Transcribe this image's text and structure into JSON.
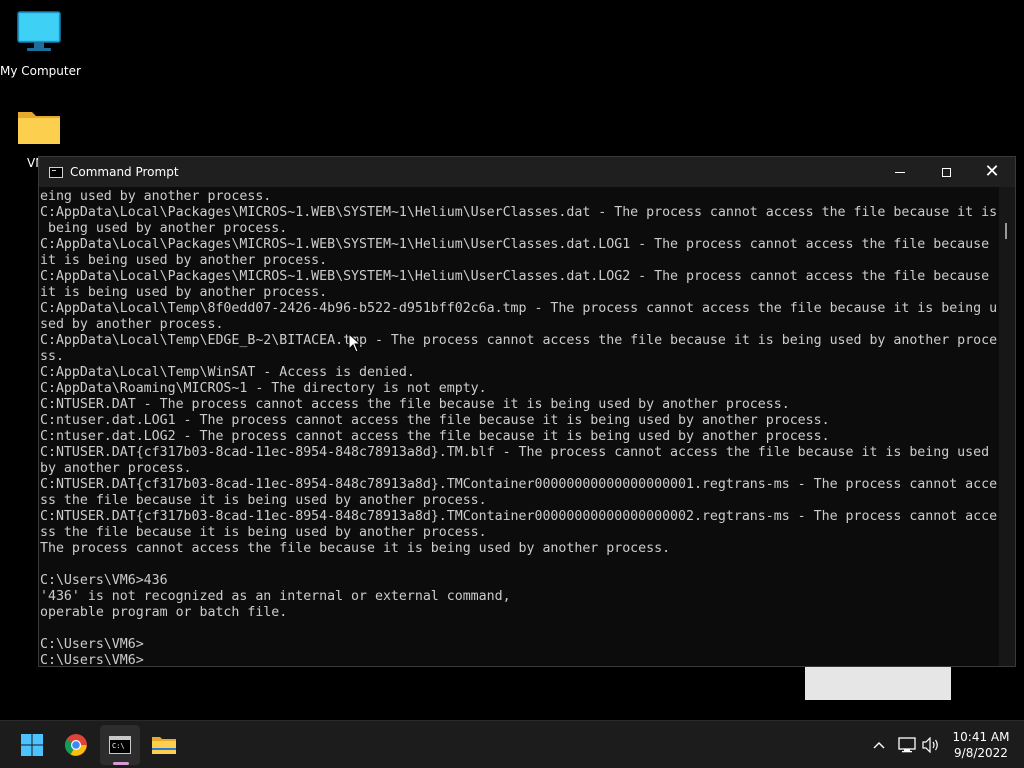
{
  "desktop": {
    "icons": [
      {
        "label": "My Computer",
        "icon": "monitor-icon"
      },
      {
        "label": "VM",
        "icon": "folder-icon"
      }
    ]
  },
  "window": {
    "title": "Command Prompt",
    "controls": {
      "minimize": "minimize-icon",
      "maximize": "maximize-icon",
      "close": "close-icon"
    },
    "console_lines": [
      "eing used by another process.",
      "C:AppData\\Local\\Packages\\MICROS~1.WEB\\SYSTEM~1\\Helium\\UserClasses.dat - The process cannot access the file because it is",
      " being used by another process.",
      "C:AppData\\Local\\Packages\\MICROS~1.WEB\\SYSTEM~1\\Helium\\UserClasses.dat.LOG1 - The process cannot access the file because",
      "it is being used by another process.",
      "C:AppData\\Local\\Packages\\MICROS~1.WEB\\SYSTEM~1\\Helium\\UserClasses.dat.LOG2 - The process cannot access the file because",
      "it is being used by another process.",
      "C:AppData\\Local\\Temp\\8f0edd07-2426-4b96-b522-d951bff02c6a.tmp - The process cannot access the file because it is being u",
      "sed by another process.",
      "C:AppData\\Local\\Temp\\EDGE_B~2\\BITACEA.tmp - The process cannot access the file because it is being used by another proce",
      "ss.",
      "C:AppData\\Local\\Temp\\WinSAT - Access is denied.",
      "C:AppData\\Roaming\\MICROS~1 - The directory is not empty.",
      "C:NTUSER.DAT - The process cannot access the file because it is being used by another process.",
      "C:ntuser.dat.LOG1 - The process cannot access the file because it is being used by another process.",
      "C:ntuser.dat.LOG2 - The process cannot access the file because it is being used by another process.",
      "C:NTUSER.DAT{cf317b03-8cad-11ec-8954-848c78913a8d}.TM.blf - The process cannot access the file because it is being used",
      "by another process.",
      "C:NTUSER.DAT{cf317b03-8cad-11ec-8954-848c78913a8d}.TMContainer00000000000000000001.regtrans-ms - The process cannot acce",
      "ss the file because it is being used by another process.",
      "C:NTUSER.DAT{cf317b03-8cad-11ec-8954-848c78913a8d}.TMContainer00000000000000000002.regtrans-ms - The process cannot acce",
      "ss the file because it is being used by another process.",
      "The process cannot access the file because it is being used by another process.",
      "",
      "C:\\Users\\VM6>436",
      "'436' is not recognized as an internal or external command,",
      "operable program or batch file.",
      "",
      "C:\\Users\\VM6>",
      "C:\\Users\\VM6>"
    ]
  },
  "taskbar": {
    "apps": [
      {
        "name": "Start",
        "icon": "windows-start-icon"
      },
      {
        "name": "Chrome",
        "icon": "chrome-icon"
      },
      {
        "name": "Command Prompt",
        "icon": "cmd-icon",
        "active": true
      },
      {
        "name": "File Explorer",
        "icon": "folder-icon"
      }
    ],
    "tray_icons": [
      "chevron-up-icon",
      "network-icon",
      "volume-icon"
    ],
    "clock": {
      "time": "10:41 AM",
      "date": "9/8/2022"
    }
  },
  "colors": {
    "desktop_bg": "#000000",
    "console_bg": "#0c0c0c",
    "console_text": "#cccccc",
    "titlebar_bg": "#1f1f1f",
    "taskbar_bg": "#1c1c1c",
    "active_indicator": "#d79ad7"
  }
}
